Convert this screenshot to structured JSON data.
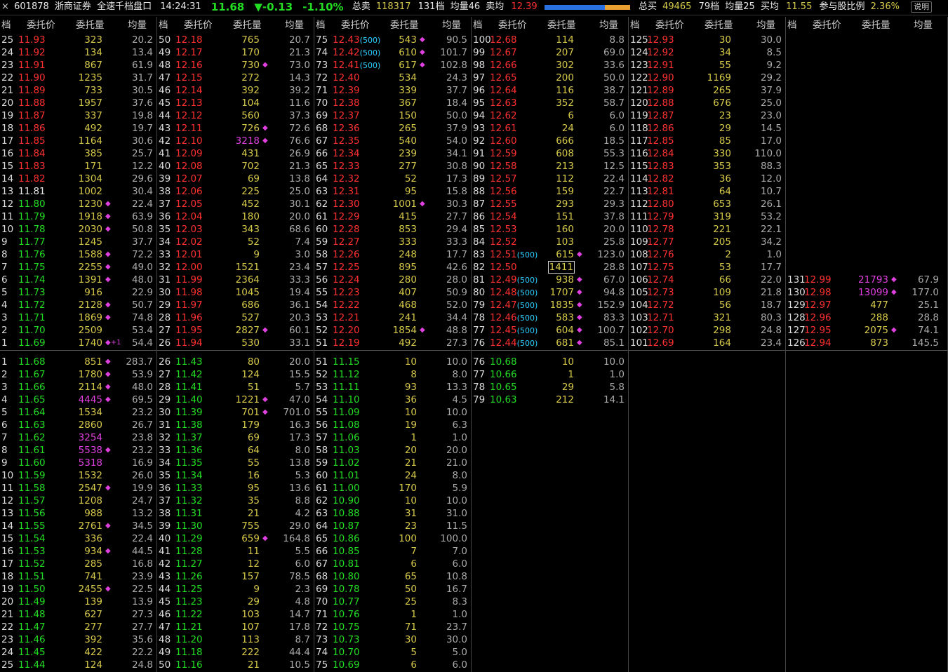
{
  "topbar": {
    "close": "×",
    "code": "601878",
    "name": "浙商证券",
    "title": "全速千档盘口",
    "time": "14:24:31",
    "price": "11.68",
    "change": "▼-0.13",
    "pct": "-1.10%",
    "sell_label": "总卖",
    "sell_total": "118317",
    "sell_levels": "131档",
    "sell_avg_label": "均量46",
    "sell_avg_price_label": "卖均",
    "sell_avg_price": "12.39",
    "buy_label": "总买",
    "buy_total": "49465",
    "buy_levels": "79档",
    "buy_avg_label": "均量25",
    "buy_avg_price_label": "买均",
    "buy_avg_price": "11.55",
    "ratio_label": "参与股比例",
    "ratio": "2.36%",
    "help_button": "说明",
    "bar_buy_fraction": 0.71
  },
  "headers": {
    "level": "档",
    "price": "委托价",
    "qty": "委托量",
    "avg": "均量"
  },
  "colors": {
    "up": "#ff3030",
    "down": "#22dd22",
    "flat": "#e8e8e8",
    "qty": "#d6c94a",
    "big": "#e040e0"
  },
  "asks": [
    [
      "25",
      "11.93",
      "323",
      "20.2",
      ""
    ],
    [
      "24",
      "11.92",
      "134",
      "13.4",
      ""
    ],
    [
      "23",
      "11.91",
      "867",
      "61.9",
      ""
    ],
    [
      "22",
      "11.90",
      "1235",
      "31.7",
      ""
    ],
    [
      "21",
      "11.89",
      "733",
      "30.5",
      ""
    ],
    [
      "20",
      "11.88",
      "1957",
      "37.6",
      ""
    ],
    [
      "19",
      "11.87",
      "337",
      "19.8",
      ""
    ],
    [
      "18",
      "11.86",
      "492",
      "19.7",
      ""
    ],
    [
      "17",
      "11.85",
      "1164",
      "30.6",
      ""
    ],
    [
      "16",
      "11.84",
      "385",
      "25.7",
      ""
    ],
    [
      "15",
      "11.83",
      "171",
      "12.2",
      ""
    ],
    [
      "14",
      "11.82",
      "1304",
      "29.6",
      ""
    ],
    [
      "13",
      "11.81",
      "1002",
      "30.4",
      ""
    ],
    [
      "12",
      "11.80",
      "1230",
      "22.4",
      "◆"
    ],
    [
      "11",
      "11.79",
      "1918",
      "63.9",
      "◆"
    ],
    [
      "10",
      "11.78",
      "2030",
      "50.8",
      "◆"
    ],
    [
      "9",
      "11.77",
      "1245",
      "37.7",
      ""
    ],
    [
      "8",
      "11.76",
      "1588",
      "72.2",
      "◆"
    ],
    [
      "7",
      "11.75",
      "2255",
      "49.0",
      "◆"
    ],
    [
      "6",
      "11.74",
      "1391",
      "48.0",
      "◆"
    ],
    [
      "5",
      "11.73",
      "916",
      "22.9",
      ""
    ],
    [
      "4",
      "11.72",
      "2128",
      "50.7",
      "◆"
    ],
    [
      "3",
      "11.71",
      "1869",
      "74.8",
      "◆"
    ],
    [
      "2",
      "11.70",
      "2509",
      "53.4",
      ""
    ],
    [
      "1",
      "11.69",
      "1740",
      "54.4",
      "◆+1"
    ],
    [
      "50",
      "12.18",
      "765",
      "20.7",
      ""
    ],
    [
      "49",
      "12.17",
      "170",
      "21.3",
      ""
    ],
    [
      "48",
      "12.16",
      "730",
      "73.0",
      "◆"
    ],
    [
      "47",
      "12.15",
      "272",
      "14.3",
      ""
    ],
    [
      "46",
      "12.14",
      "392",
      "39.2",
      ""
    ],
    [
      "45",
      "12.13",
      "104",
      "11.6",
      ""
    ],
    [
      "44",
      "12.12",
      "560",
      "37.3",
      ""
    ],
    [
      "43",
      "12.11",
      "726",
      "72.6",
      "◆"
    ],
    [
      "42",
      "12.10",
      "3218",
      "76.6",
      "◆"
    ],
    [
      "41",
      "12.09",
      "431",
      "26.9",
      ""
    ],
    [
      "40",
      "12.08",
      "702",
      "21.3",
      ""
    ],
    [
      "39",
      "12.07",
      "69",
      "13.8",
      ""
    ],
    [
      "38",
      "12.06",
      "225",
      "25.0",
      ""
    ],
    [
      "37",
      "12.05",
      "452",
      "30.1",
      ""
    ],
    [
      "36",
      "12.04",
      "180",
      "20.0",
      ""
    ],
    [
      "35",
      "12.03",
      "343",
      "68.6",
      ""
    ],
    [
      "34",
      "12.02",
      "52",
      "7.4",
      ""
    ],
    [
      "33",
      "12.01",
      "9",
      "3.0",
      ""
    ],
    [
      "32",
      "12.00",
      "1521",
      "23.4",
      ""
    ],
    [
      "31",
      "11.99",
      "2364",
      "33.3",
      ""
    ],
    [
      "30",
      "11.98",
      "1045",
      "19.4",
      ""
    ],
    [
      "29",
      "11.97",
      "686",
      "36.1",
      ""
    ],
    [
      "28",
      "11.96",
      "527",
      "20.3",
      ""
    ],
    [
      "27",
      "11.95",
      "2827",
      "60.1",
      "◆"
    ],
    [
      "26",
      "11.94",
      "530",
      "33.1",
      ""
    ],
    [
      "75",
      "12.43",
      "543",
      "90.5",
      "◆",
      "500"
    ],
    [
      "74",
      "12.42",
      "610",
      "101.7",
      "◆",
      "500"
    ],
    [
      "73",
      "12.41",
      "617",
      "102.8",
      "◆",
      "500"
    ],
    [
      "72",
      "12.40",
      "534",
      "24.3",
      ""
    ],
    [
      "71",
      "12.39",
      "339",
      "37.7",
      ""
    ],
    [
      "70",
      "12.38",
      "367",
      "18.4",
      ""
    ],
    [
      "69",
      "12.37",
      "150",
      "50.0",
      ""
    ],
    [
      "68",
      "12.36",
      "265",
      "37.9",
      ""
    ],
    [
      "67",
      "12.35",
      "540",
      "54.0",
      ""
    ],
    [
      "66",
      "12.34",
      "239",
      "34.1",
      ""
    ],
    [
      "65",
      "12.33",
      "277",
      "30.8",
      ""
    ],
    [
      "64",
      "12.32",
      "52",
      "17.3",
      ""
    ],
    [
      "63",
      "12.31",
      "95",
      "15.8",
      ""
    ],
    [
      "62",
      "12.30",
      "1001",
      "30.3",
      "◆"
    ],
    [
      "61",
      "12.29",
      "415",
      "27.7",
      ""
    ],
    [
      "60",
      "12.28",
      "853",
      "29.4",
      ""
    ],
    [
      "59",
      "12.27",
      "333",
      "33.3",
      ""
    ],
    [
      "58",
      "12.26",
      "248",
      "17.7",
      ""
    ],
    [
      "57",
      "12.25",
      "895",
      "42.6",
      ""
    ],
    [
      "56",
      "12.24",
      "280",
      "28.0",
      ""
    ],
    [
      "55",
      "12.23",
      "407",
      "50.9",
      ""
    ],
    [
      "54",
      "12.22",
      "468",
      "52.0",
      ""
    ],
    [
      "53",
      "12.21",
      "241",
      "34.4",
      ""
    ],
    [
      "52",
      "12.20",
      "1854",
      "48.8",
      "◆"
    ],
    [
      "51",
      "12.19",
      "492",
      "27.3",
      ""
    ],
    [
      "100",
      "12.68",
      "114",
      "8.8",
      ""
    ],
    [
      "99",
      "12.67",
      "207",
      "69.0",
      ""
    ],
    [
      "98",
      "12.66",
      "302",
      "33.6",
      ""
    ],
    [
      "97",
      "12.65",
      "200",
      "50.0",
      ""
    ],
    [
      "96",
      "12.64",
      "116",
      "38.7",
      ""
    ],
    [
      "95",
      "12.63",
      "352",
      "58.7",
      ""
    ],
    [
      "94",
      "12.62",
      "6",
      "6.0",
      ""
    ],
    [
      "93",
      "12.61",
      "24",
      "6.0",
      ""
    ],
    [
      "92",
      "12.60",
      "666",
      "18.5",
      ""
    ],
    [
      "91",
      "12.59",
      "608",
      "55.3",
      ""
    ],
    [
      "90",
      "12.58",
      "213",
      "12.5",
      ""
    ],
    [
      "89",
      "12.57",
      "112",
      "22.4",
      ""
    ],
    [
      "88",
      "12.56",
      "159",
      "22.7",
      ""
    ],
    [
      "87",
      "12.55",
      "293",
      "29.3",
      ""
    ],
    [
      "86",
      "12.54",
      "151",
      "37.8",
      ""
    ],
    [
      "85",
      "12.53",
      "160",
      "20.0",
      ""
    ],
    [
      "84",
      "12.52",
      "103",
      "25.8",
      ""
    ],
    [
      "83",
      "12.51",
      "615",
      "123.0",
      "◆",
      "500"
    ],
    [
      "82",
      "12.50",
      "1411",
      "28.8",
      "",
      "",
      "hl"
    ],
    [
      "81",
      "12.49",
      "938",
      "67.0",
      "◆",
      "500"
    ],
    [
      "80",
      "12.48",
      "1707",
      "94.8",
      "◆",
      "500"
    ],
    [
      "79",
      "12.47",
      "1835",
      "152.9",
      "◆",
      "500"
    ],
    [
      "78",
      "12.46",
      "583",
      "83.3",
      "◆",
      "500"
    ],
    [
      "77",
      "12.45",
      "604",
      "100.7",
      "◆",
      "500"
    ],
    [
      "76",
      "12.44",
      "681",
      "85.1",
      "◆",
      "500"
    ],
    [
      "125",
      "12.93",
      "30",
      "30.0",
      ""
    ],
    [
      "124",
      "12.92",
      "34",
      "8.5",
      ""
    ],
    [
      "123",
      "12.91",
      "55",
      "9.2",
      ""
    ],
    [
      "122",
      "12.90",
      "1169",
      "29.2",
      ""
    ],
    [
      "121",
      "12.89",
      "265",
      "37.9",
      ""
    ],
    [
      "120",
      "12.88",
      "676",
      "25.0",
      ""
    ],
    [
      "119",
      "12.87",
      "23",
      "23.0",
      ""
    ],
    [
      "118",
      "12.86",
      "29",
      "14.5",
      ""
    ],
    [
      "117",
      "12.85",
      "85",
      "17.0",
      ""
    ],
    [
      "116",
      "12.84",
      "330",
      "110.0",
      ""
    ],
    [
      "115",
      "12.83",
      "353",
      "88.3",
      ""
    ],
    [
      "114",
      "12.82",
      "36",
      "12.0",
      ""
    ],
    [
      "113",
      "12.81",
      "64",
      "10.7",
      ""
    ],
    [
      "112",
      "12.80",
      "653",
      "26.1",
      ""
    ],
    [
      "111",
      "12.79",
      "319",
      "53.2",
      ""
    ],
    [
      "110",
      "12.78",
      "221",
      "22.1",
      ""
    ],
    [
      "109",
      "12.77",
      "205",
      "34.2",
      ""
    ],
    [
      "108",
      "12.76",
      "2",
      "1.0",
      ""
    ],
    [
      "107",
      "12.75",
      "53",
      "17.7",
      ""
    ],
    [
      "106",
      "12.74",
      "66",
      "22.0",
      ""
    ],
    [
      "105",
      "12.73",
      "109",
      "21.8",
      ""
    ],
    [
      "104",
      "12.72",
      "56",
      "18.7",
      ""
    ],
    [
      "103",
      "12.71",
      "321",
      "80.3",
      ""
    ],
    [
      "102",
      "12.70",
      "298",
      "24.8",
      ""
    ],
    [
      "101",
      "12.69",
      "164",
      "23.4",
      ""
    ],
    [
      "131",
      "12.99",
      "21793",
      "67.9",
      "◆"
    ],
    [
      "130",
      "12.98",
      "13099",
      "177.0",
      "◆"
    ],
    [
      "129",
      "12.97",
      "477",
      "25.1",
      ""
    ],
    [
      "128",
      "12.96",
      "288",
      "28.8",
      ""
    ],
    [
      "127",
      "12.95",
      "2075",
      "74.1",
      "◆"
    ],
    [
      "126",
      "12.94",
      "873",
      "145.5",
      ""
    ]
  ],
  "bids": [
    [
      "1",
      "11.68",
      "851",
      "283.7",
      "◆"
    ],
    [
      "2",
      "11.67",
      "1780",
      "53.9",
      "◆"
    ],
    [
      "3",
      "11.66",
      "2114",
      "48.0",
      "◆"
    ],
    [
      "4",
      "11.65",
      "4445",
      "69.5",
      "◆"
    ],
    [
      "5",
      "11.64",
      "1534",
      "23.2",
      ""
    ],
    [
      "6",
      "11.63",
      "2860",
      "26.7",
      ""
    ],
    [
      "7",
      "11.62",
      "3254",
      "23.8",
      ""
    ],
    [
      "8",
      "11.61",
      "5538",
      "23.2",
      "◆"
    ],
    [
      "9",
      "11.60",
      "5318",
      "16.9",
      ""
    ],
    [
      "10",
      "11.59",
      "1532",
      "26.0",
      ""
    ],
    [
      "11",
      "11.58",
      "2547",
      "19.9",
      "◆"
    ],
    [
      "12",
      "11.57",
      "1208",
      "24.7",
      ""
    ],
    [
      "13",
      "11.56",
      "988",
      "13.2",
      ""
    ],
    [
      "14",
      "11.55",
      "2761",
      "34.5",
      "◆"
    ],
    [
      "15",
      "11.54",
      "336",
      "22.4",
      ""
    ],
    [
      "16",
      "11.53",
      "934",
      "44.5",
      "◆"
    ],
    [
      "17",
      "11.52",
      "285",
      "16.8",
      ""
    ],
    [
      "18",
      "11.51",
      "741",
      "23.9",
      ""
    ],
    [
      "19",
      "11.50",
      "2455",
      "22.5",
      "◆"
    ],
    [
      "20",
      "11.49",
      "139",
      "13.9",
      ""
    ],
    [
      "21",
      "11.48",
      "627",
      "27.3",
      ""
    ],
    [
      "22",
      "11.47",
      "277",
      "27.7",
      ""
    ],
    [
      "23",
      "11.46",
      "392",
      "35.6",
      ""
    ],
    [
      "24",
      "11.45",
      "422",
      "22.2",
      ""
    ],
    [
      "25",
      "11.44",
      "124",
      "24.8",
      ""
    ],
    [
      "26",
      "11.43",
      "80",
      "20.0",
      ""
    ],
    [
      "27",
      "11.42",
      "124",
      "15.5",
      ""
    ],
    [
      "28",
      "11.41",
      "51",
      "5.7",
      ""
    ],
    [
      "29",
      "11.40",
      "1221",
      "47.0",
      "◆"
    ],
    [
      "30",
      "11.39",
      "701",
      "701.0",
      "◆"
    ],
    [
      "31",
      "11.38",
      "179",
      "16.3",
      ""
    ],
    [
      "32",
      "11.37",
      "69",
      "17.3",
      ""
    ],
    [
      "33",
      "11.36",
      "64",
      "8.0",
      ""
    ],
    [
      "34",
      "11.35",
      "55",
      "13.8",
      ""
    ],
    [
      "35",
      "11.34",
      "16",
      "5.3",
      ""
    ],
    [
      "36",
      "11.33",
      "95",
      "13.6",
      ""
    ],
    [
      "37",
      "11.32",
      "35",
      "8.8",
      ""
    ],
    [
      "38",
      "11.31",
      "21",
      "4.2",
      ""
    ],
    [
      "39",
      "11.30",
      "755",
      "29.0",
      ""
    ],
    [
      "40",
      "11.29",
      "659",
      "164.8",
      "◆"
    ],
    [
      "41",
      "11.28",
      "11",
      "5.5",
      ""
    ],
    [
      "42",
      "11.27",
      "12",
      "6.0",
      ""
    ],
    [
      "43",
      "11.26",
      "157",
      "78.5",
      ""
    ],
    [
      "44",
      "11.25",
      "9",
      "2.3",
      ""
    ],
    [
      "45",
      "11.23",
      "29",
      "4.8",
      ""
    ],
    [
      "46",
      "11.22",
      "103",
      "14.7",
      ""
    ],
    [
      "47",
      "11.21",
      "107",
      "17.8",
      ""
    ],
    [
      "48",
      "11.20",
      "113",
      "8.7",
      ""
    ],
    [
      "49",
      "11.18",
      "222",
      "44.4",
      ""
    ],
    [
      "50",
      "11.16",
      "21",
      "10.5",
      ""
    ],
    [
      "51",
      "11.15",
      "10",
      "10.0",
      ""
    ],
    [
      "52",
      "11.12",
      "8",
      "8.0",
      ""
    ],
    [
      "53",
      "11.11",
      "93",
      "13.3",
      ""
    ],
    [
      "54",
      "11.10",
      "36",
      "4.5",
      ""
    ],
    [
      "55",
      "11.09",
      "10",
      "10.0",
      ""
    ],
    [
      "56",
      "11.08",
      "19",
      "6.3",
      ""
    ],
    [
      "57",
      "11.06",
      "1",
      "1.0",
      ""
    ],
    [
      "58",
      "11.03",
      "20",
      "20.0",
      ""
    ],
    [
      "59",
      "11.02",
      "21",
      "21.0",
      ""
    ],
    [
      "60",
      "11.01",
      "24",
      "8.0",
      ""
    ],
    [
      "61",
      "11.00",
      "170",
      "5.9",
      ""
    ],
    [
      "62",
      "10.90",
      "10",
      "10.0",
      ""
    ],
    [
      "63",
      "10.88",
      "31",
      "31.0",
      ""
    ],
    [
      "64",
      "10.87",
      "23",
      "11.5",
      ""
    ],
    [
      "65",
      "10.86",
      "100",
      "100.0",
      ""
    ],
    [
      "66",
      "10.85",
      "7",
      "7.0",
      ""
    ],
    [
      "67",
      "10.81",
      "6",
      "6.0",
      ""
    ],
    [
      "68",
      "10.80",
      "65",
      "10.8",
      ""
    ],
    [
      "69",
      "10.78",
      "50",
      "16.7",
      ""
    ],
    [
      "70",
      "10.77",
      "25",
      "8.3",
      ""
    ],
    [
      "71",
      "10.76",
      "1",
      "1.0",
      ""
    ],
    [
      "72",
      "10.75",
      "71",
      "23.7",
      ""
    ],
    [
      "73",
      "10.73",
      "30",
      "30.0",
      ""
    ],
    [
      "74",
      "10.70",
      "5",
      "5.0",
      ""
    ],
    [
      "75",
      "10.69",
      "6",
      "6.0",
      ""
    ],
    [
      "76",
      "10.68",
      "10",
      "10.0",
      ""
    ],
    [
      "77",
      "10.66",
      "1",
      "1.0",
      ""
    ],
    [
      "78",
      "10.65",
      "29",
      "5.8",
      ""
    ],
    [
      "79",
      "10.63",
      "212",
      "14.1",
      ""
    ]
  ]
}
